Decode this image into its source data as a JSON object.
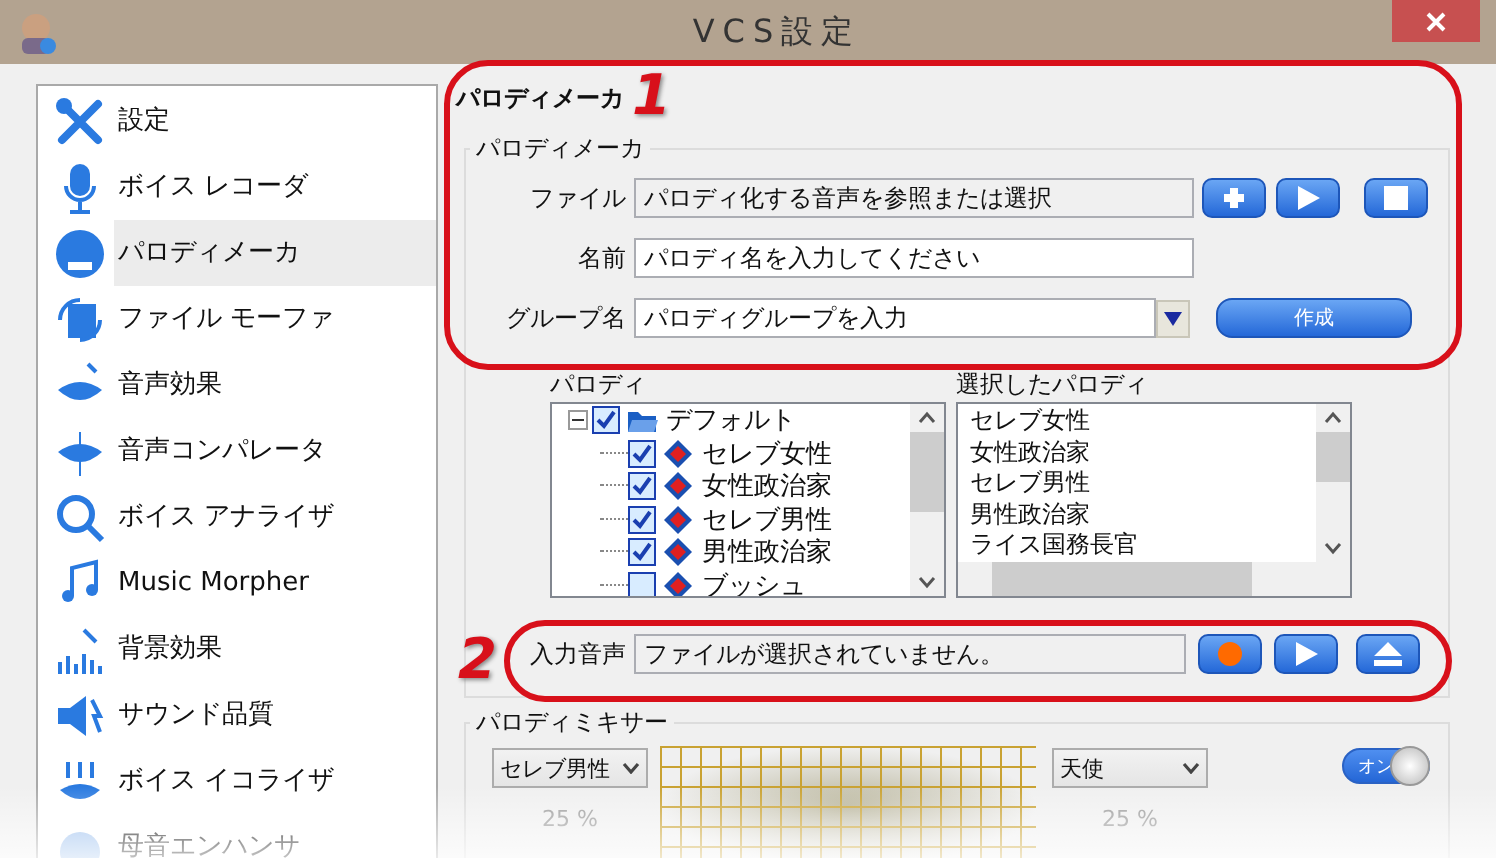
{
  "window": {
    "title": "VCS設定"
  },
  "sidebar": {
    "items": [
      {
        "label": "設定",
        "selected": false
      },
      {
        "label": "ボイス レコーダ",
        "selected": false
      },
      {
        "label": "パロディメーカ",
        "selected": true
      },
      {
        "label": "ファイル モーファ",
        "selected": false
      },
      {
        "label": "音声効果",
        "selected": false
      },
      {
        "label": "音声コンパレータ",
        "selected": false
      },
      {
        "label": "ボイス アナライザ",
        "selected": false
      },
      {
        "label": "Music Morpher",
        "selected": false
      },
      {
        "label": "背景効果",
        "selected": false
      },
      {
        "label": "サウンド品質",
        "selected": false
      },
      {
        "label": "ボイス イコライザ",
        "selected": false
      },
      {
        "label": "母音エンハンサ",
        "selected": false
      }
    ]
  },
  "parody_maker": {
    "heading": "パロディメーカ",
    "group_title": "パロディメーカ",
    "fields": [
      {
        "kind": "file",
        "label": "ファイル",
        "value": "パロディ化する音声を参照または選択"
      },
      {
        "kind": "text",
        "label": "名前",
        "value": "パロディ名を入力してください"
      },
      {
        "kind": "combo",
        "label": "グループ名",
        "value": "パロディグループを入力",
        "button": "作成"
      }
    ],
    "parody_list": {
      "title": "パロディ",
      "tree": [
        {
          "label": "デフォルト",
          "checked": true,
          "expanded": true,
          "children": [
            {
              "label": "セレブ女性",
              "checked": true
            },
            {
              "label": "女性政治家",
              "checked": true
            },
            {
              "label": "セレブ男性",
              "checked": true
            },
            {
              "label": "男性政治家",
              "checked": true
            },
            {
              "label": "ブッシュ",
              "checked": false
            }
          ]
        }
      ]
    },
    "selected_list": {
      "title": "選択したパロディ",
      "items": [
        "セレブ女性",
        "女性政治家",
        "セレブ男性",
        "男性政治家",
        "ライス国務長官"
      ]
    },
    "input_audio": {
      "label": "入力音声",
      "value": "ファイルが選択されていません。"
    }
  },
  "mixer": {
    "title": "パロディミキサー",
    "left": {
      "value": "セレブ男性",
      "percent": "25 %"
    },
    "right": {
      "value": "天使",
      "percent": "25 %"
    },
    "toggle": {
      "label": "オン",
      "on": true
    }
  },
  "annotations": [
    {
      "number": "1"
    },
    {
      "number": "2"
    }
  ]
}
